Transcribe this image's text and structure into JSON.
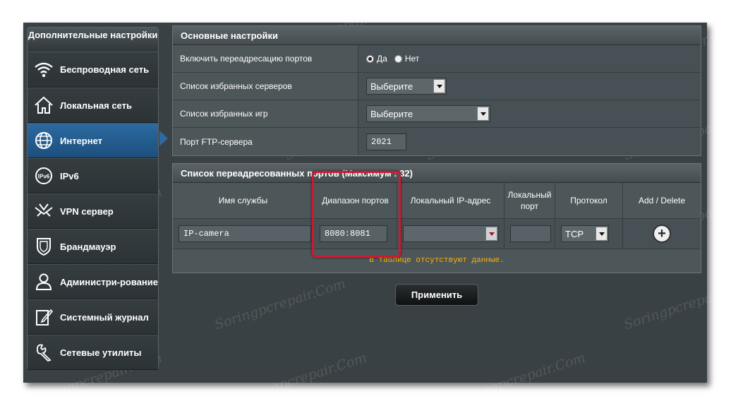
{
  "sidebar": {
    "title": "Дополнительные настройки",
    "items": [
      {
        "label": "Беспроводная сеть",
        "icon": "wifi-icon",
        "active": false
      },
      {
        "label": "Локальная сеть",
        "icon": "home-icon",
        "active": false
      },
      {
        "label": "Интернет",
        "icon": "globe-icon",
        "active": true
      },
      {
        "label": "IPv6",
        "icon": "ipv6-globe-icon",
        "active": false
      },
      {
        "label": "VPN сервер",
        "icon": "vpn-icon",
        "active": false
      },
      {
        "label": "Брандмауэр",
        "icon": "shield-icon",
        "active": false
      },
      {
        "label": "Администри-рование",
        "icon": "admin-user-icon",
        "active": false
      },
      {
        "label": "Системный журнал",
        "icon": "log-edit-icon",
        "active": false
      },
      {
        "label": "Сетевые утилиты",
        "icon": "tools-icon",
        "active": false
      }
    ]
  },
  "basic": {
    "title": "Основные настройки",
    "enable_label": "Включить переадресацию портов",
    "yes_label": "Да",
    "no_label": "Нет",
    "enable_value": "Да",
    "servers_label": "Список избранных серверов",
    "servers_select": "Выберите",
    "games_label": "Список избранных игр",
    "games_select": "Выберите",
    "ftp_label": "Порт FTP-сервера",
    "ftp_value": "2021"
  },
  "forward_list": {
    "title": "Список переадресованных портов (Максимум : 32)",
    "columns": [
      "Имя службы",
      "Диапазон портов",
      "Локальный IP-адрес",
      "Локальный порт",
      "Протокол",
      "Add / Delete"
    ],
    "input_row": {
      "service_name": "IP-camera",
      "port_range": "8080:8081",
      "local_ip": "",
      "local_port": "",
      "protocol": "TCP"
    },
    "empty_text": "В таблице отсутствуют данные."
  },
  "apply_label": "Применить",
  "watermark_text": "Soringpcrepair.Com",
  "colors": {
    "active_nav": "#2c6aa0",
    "highlight": "#d01830",
    "empty_text": "#ffb300"
  }
}
